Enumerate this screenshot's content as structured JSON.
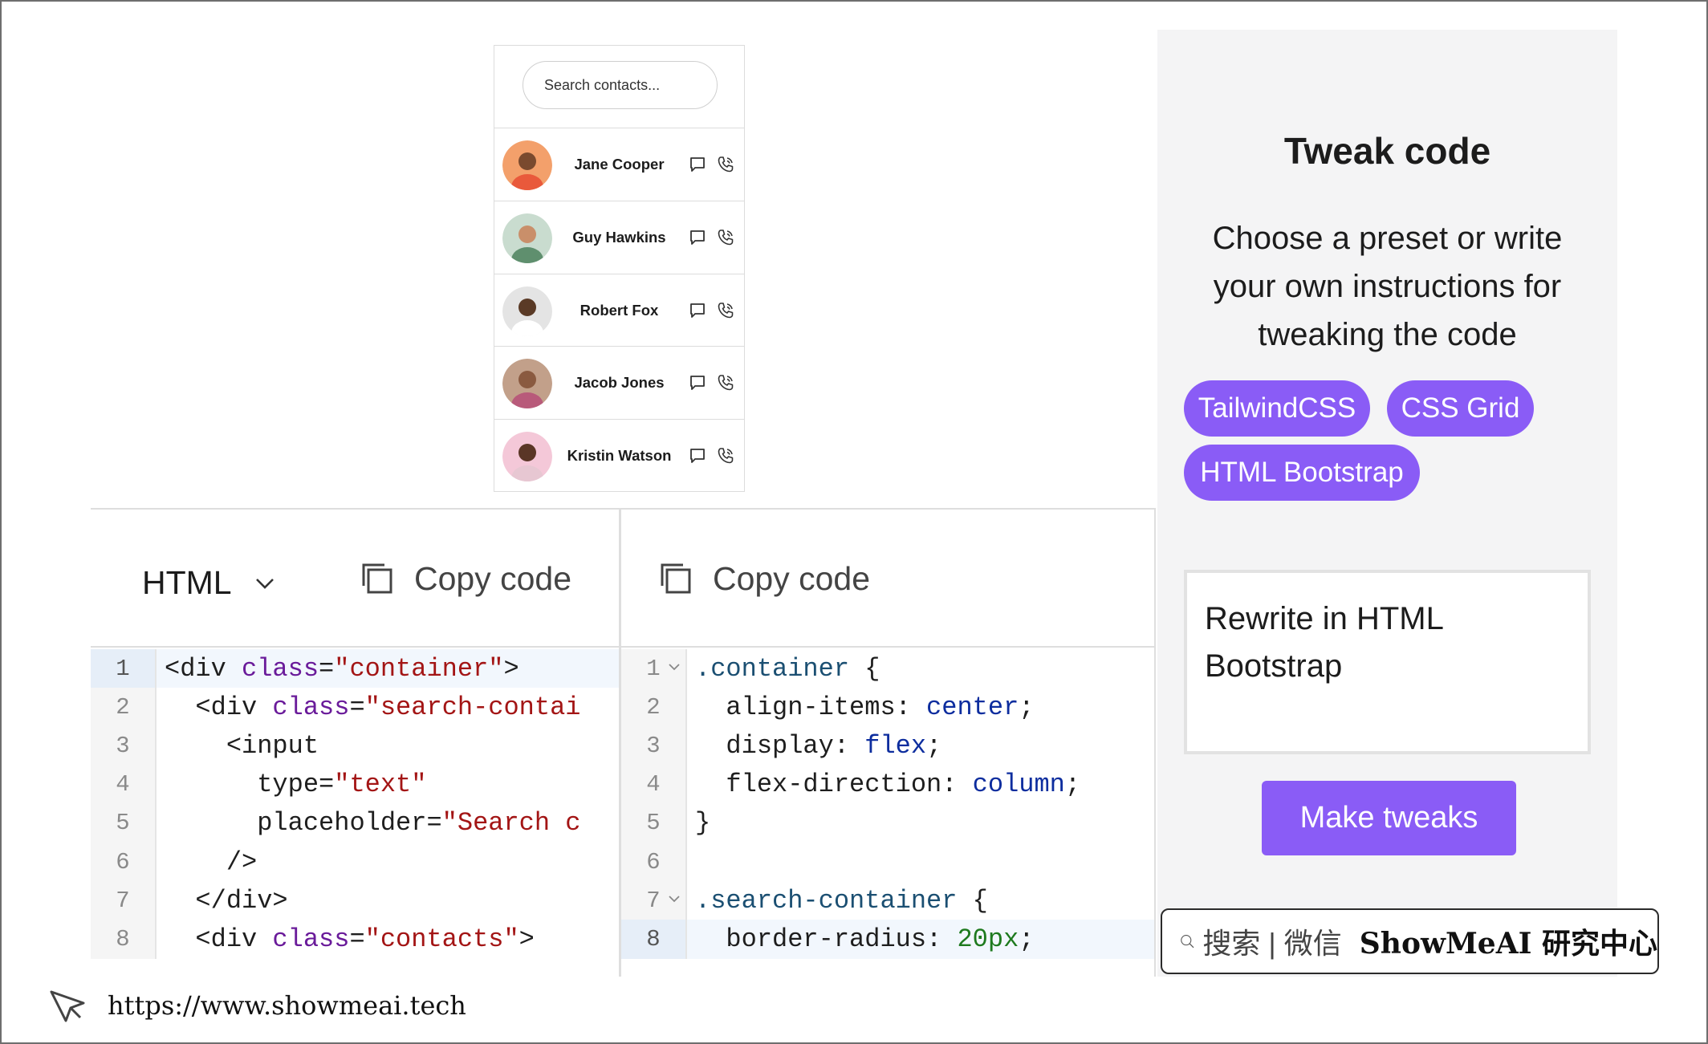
{
  "contacts": {
    "search_placeholder": "Search contacts...",
    "items": [
      {
        "name": "Jane Cooper",
        "avatar_bg": "#f3a06b",
        "skin": "#7a4a2e",
        "shirt": "#e9593b"
      },
      {
        "name": "Guy Hawkins",
        "avatar_bg": "#c9dccf",
        "skin": "#c98f6a",
        "shirt": "#5f8f6e"
      },
      {
        "name": "Robert Fox",
        "avatar_bg": "#e4e4e4",
        "skin": "#5a3a26",
        "shirt": "#ffffff"
      },
      {
        "name": "Jacob Jones",
        "avatar_bg": "#c2a08a",
        "skin": "#8a5a40",
        "shirt": "#b85a7a"
      },
      {
        "name": "Kristin Watson",
        "avatar_bg": "#f4c8d8",
        "skin": "#5a3626",
        "shirt": "#e7c7d2"
      }
    ]
  },
  "html_panel": {
    "language": "HTML",
    "copy_label": "Copy code",
    "lines": [
      {
        "n": "1",
        "parts": [
          [
            "",
            "<div "
          ],
          [
            "attr",
            "class"
          ],
          [
            "",
            "="
          ],
          [
            "str",
            "\"container\""
          ],
          [
            "",
            ">"
          ]
        ]
      },
      {
        "n": "2",
        "parts": [
          [
            "",
            "  <div "
          ],
          [
            "attr",
            "class"
          ],
          [
            "",
            "="
          ],
          [
            "str",
            "\"search-contai"
          ]
        ]
      },
      {
        "n": "3",
        "parts": [
          [
            "",
            "    <input"
          ]
        ]
      },
      {
        "n": "4",
        "parts": [
          [
            "",
            "      type="
          ],
          [
            "str",
            "\"text\""
          ]
        ]
      },
      {
        "n": "5",
        "parts": [
          [
            "",
            "      placeholder="
          ],
          [
            "str",
            "\"Search c"
          ]
        ]
      },
      {
        "n": "6",
        "parts": [
          [
            "",
            "    />"
          ]
        ]
      },
      {
        "n": "7",
        "parts": [
          [
            "",
            "  </div>"
          ]
        ]
      },
      {
        "n": "8",
        "parts": [
          [
            "",
            "  <div "
          ],
          [
            "attr",
            "class"
          ],
          [
            "",
            "="
          ],
          [
            "str",
            "\"contacts\""
          ],
          [
            "",
            ">"
          ]
        ]
      }
    ]
  },
  "css_panel": {
    "copy_label": "Copy code",
    "lines": [
      {
        "n": "1",
        "fold": true,
        "parts": [
          [
            "sel",
            ".container"
          ],
          [
            "",
            " {"
          ]
        ]
      },
      {
        "n": "2",
        "parts": [
          [
            "",
            "  align-items: "
          ],
          [
            "val",
            "center"
          ],
          [
            "",
            ";"
          ]
        ]
      },
      {
        "n": "3",
        "parts": [
          [
            "",
            "  display: "
          ],
          [
            "val",
            "flex"
          ],
          [
            "",
            ";"
          ]
        ]
      },
      {
        "n": "4",
        "parts": [
          [
            "",
            "  flex-direction: "
          ],
          [
            "val",
            "column"
          ],
          [
            "",
            ";"
          ]
        ]
      },
      {
        "n": "5",
        "parts": [
          [
            "",
            "}"
          ]
        ]
      },
      {
        "n": "6",
        "parts": [
          [
            "",
            ""
          ]
        ]
      },
      {
        "n": "7",
        "fold": true,
        "parts": [
          [
            "sel",
            ".search-container"
          ],
          [
            "",
            " {"
          ]
        ]
      },
      {
        "n": "8",
        "active": true,
        "parts": [
          [
            "",
            "  border-radius: "
          ],
          [
            "num",
            "20px"
          ],
          [
            "",
            ";"
          ]
        ]
      }
    ]
  },
  "tweak": {
    "title": "Tweak code",
    "description": "Choose a preset or write your own instructions for tweaking the code",
    "presets": [
      "TailwindCSS",
      "CSS Grid",
      "HTML Bootstrap"
    ],
    "instructions": "Rewrite in HTML Bootstrap",
    "submit_label": "Make tweaks",
    "accent": "#8a5cf6"
  },
  "watermark": {
    "text": "搜索 | 微信",
    "brand": "ShowMeAI 研究中心"
  },
  "footer": {
    "url": "https://www.showmeai.tech"
  }
}
